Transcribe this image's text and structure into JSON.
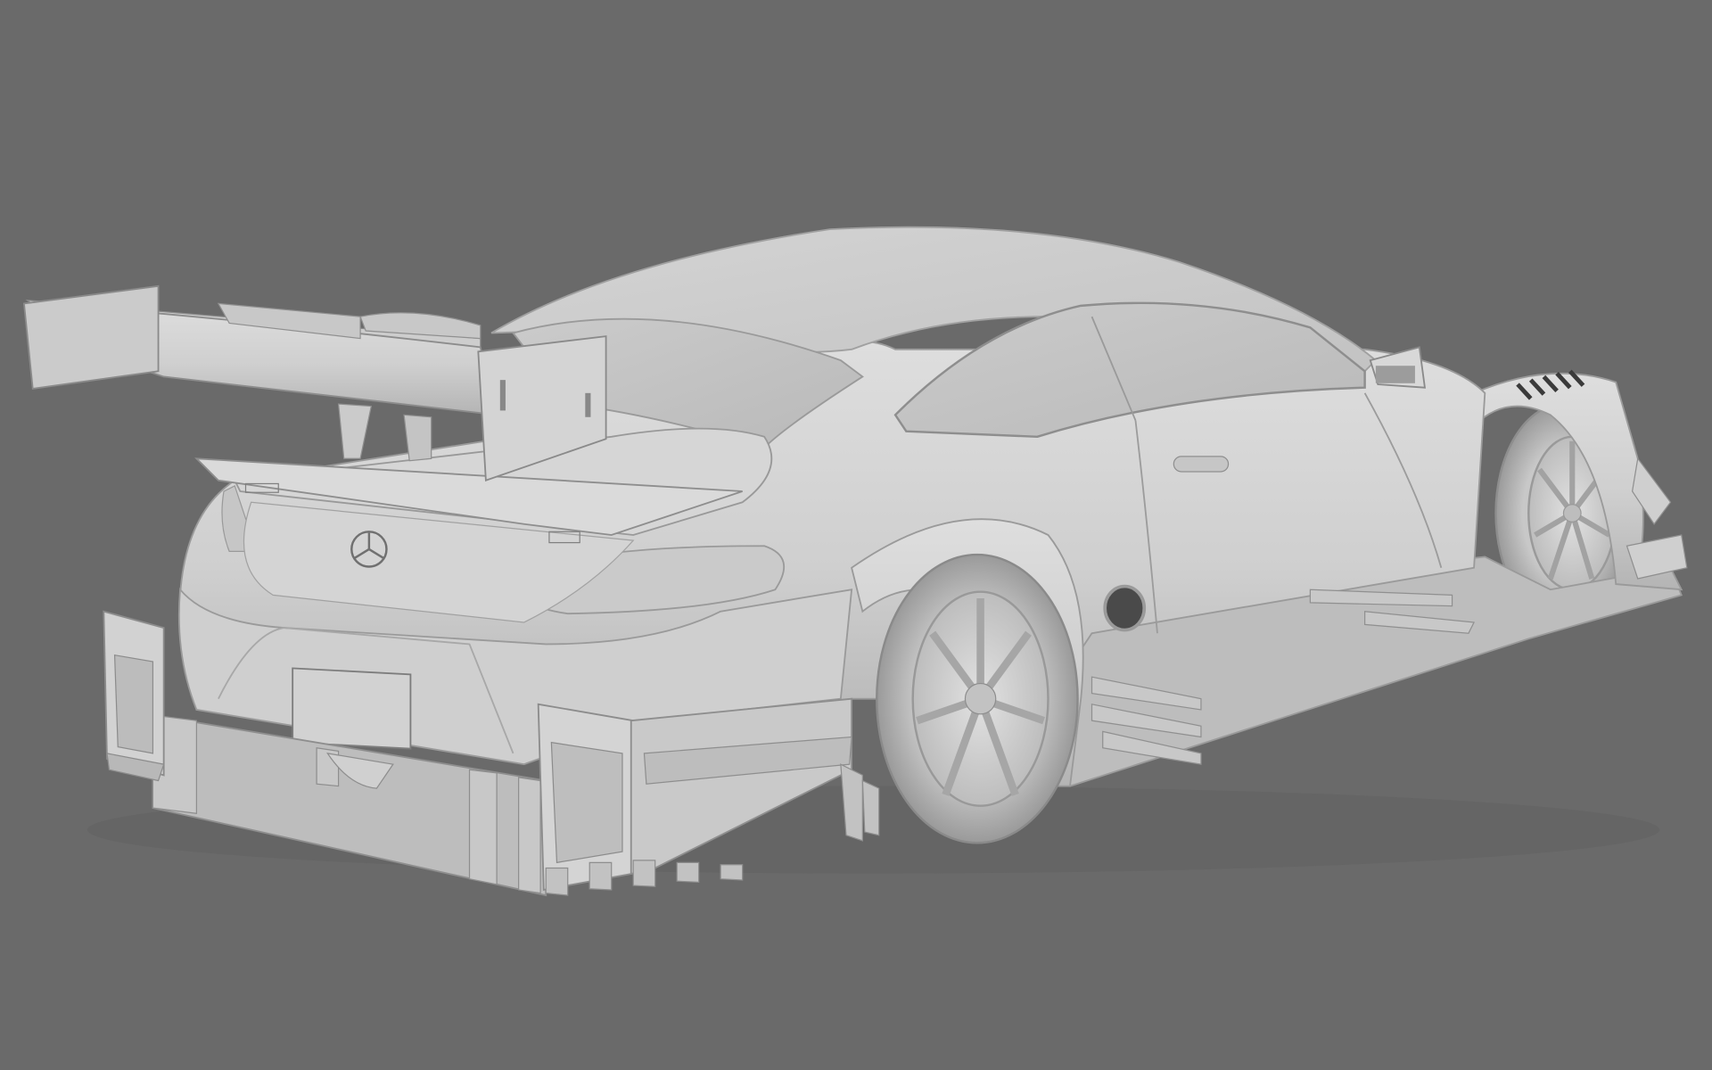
{
  "scene": {
    "background_color": "#6a6a6a",
    "subject": "race car",
    "body_color": "#d2d2d2"
  }
}
